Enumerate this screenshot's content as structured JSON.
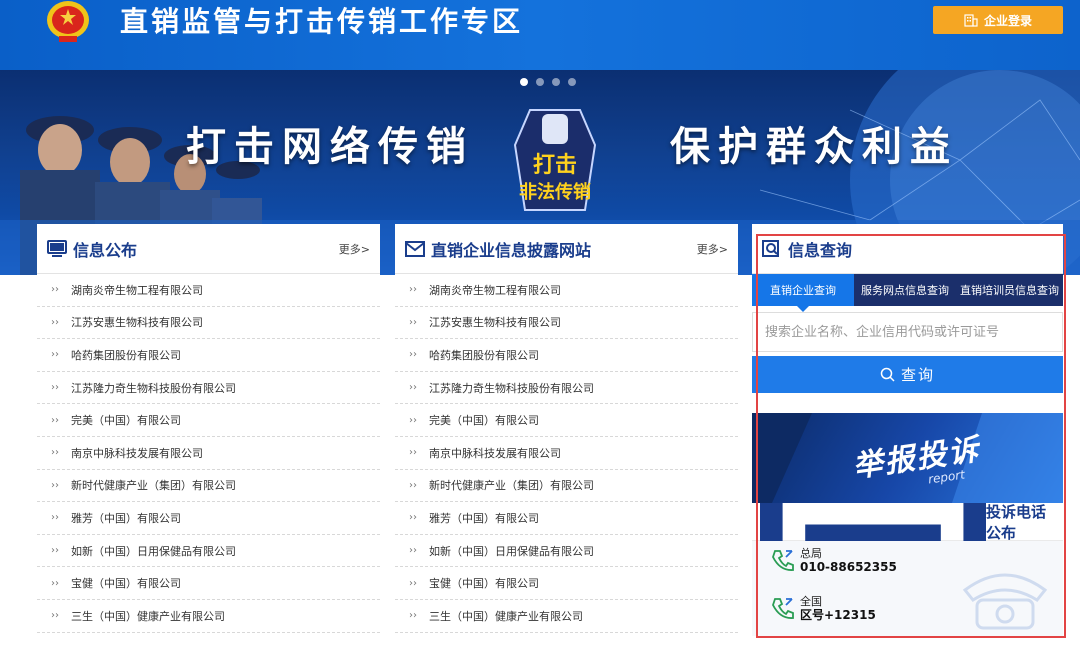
{
  "header": {
    "title": "直销监管与打击传销工作专区",
    "login_label": "企业登录",
    "colors": {
      "bar": "#1472dc",
      "login_button": "#f5a623"
    }
  },
  "banner": {
    "slogan_left": "打击网络传销",
    "slogan_right": "保护群众利益",
    "badge_text_top": "打击",
    "badge_text_bottom": "非法传销",
    "active_slide": 1,
    "slide_count": 4
  },
  "info_panel": {
    "icon": "monitor-icon",
    "title": "信息公布",
    "more_label": "更多>",
    "items": [
      "湖南炎帝生物工程有限公司",
      "江苏安惠生物科技有限公司",
      "哈药集团股份有限公司",
      "江苏隆力奇生物科技股份有限公司",
      "完美（中国）有限公司",
      "南京中脉科技发展有限公司",
      "新时代健康产业（集团）有限公司",
      "雅芳（中国）有限公司",
      "如新（中国）日用保健品有限公司",
      "宝健（中国）有限公司",
      "三生（中国）健康产业有限公司"
    ]
  },
  "disclosure_panel": {
    "icon": "envelope-icon",
    "title": "直销企业信息披露网站",
    "more_label": "更多>",
    "items": [
      "湖南炎帝生物工程有限公司",
      "江苏安惠生物科技有限公司",
      "哈药集团股份有限公司",
      "江苏隆力奇生物科技股份有限公司",
      "完美（中国）有限公司",
      "南京中脉科技发展有限公司",
      "新时代健康产业（集团）有限公司",
      "雅芳（中国）有限公司",
      "如新（中国）日用保健品有限公司",
      "宝健（中国）有限公司",
      "三生（中国）健康产业有限公司"
    ]
  },
  "query_panel": {
    "icon": "search-doc-icon",
    "title": "信息查询",
    "tabs": [
      "直销企业查询",
      "服务网点信息查询",
      "直销培训员信息查询"
    ],
    "active_tab": 0,
    "search_placeholder": "搜索企业名称、企业信用代码或许可证号",
    "search_button": "查询",
    "report_title": "举报投诉",
    "report_sub": "report",
    "phone_title": "投诉电话公布",
    "phones": [
      {
        "label": "总局",
        "number": "010-88652355"
      },
      {
        "label": "全国",
        "number": "区号+12315"
      }
    ],
    "highlight_color": "#e24444"
  }
}
